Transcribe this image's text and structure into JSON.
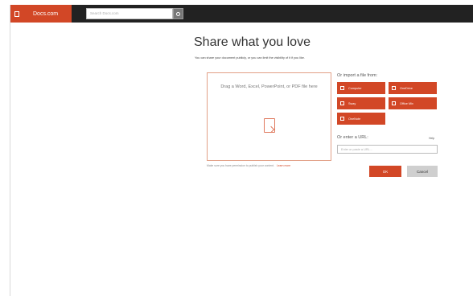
{
  "app": {
    "title": "Docs.com",
    "search_placeholder": "Search Docs.com",
    "brand_color": "#d24726"
  },
  "main": {
    "heading": "Share what you love",
    "subtext": "You can share your document publicly, or you can limit the visibility of it if you like.",
    "dropzone_text": "Drag a Word, Excel, PowerPoint, or PDF file here",
    "privacy_note": "Make sure you have permission to publish your content.",
    "privacy_link": "Learn more"
  },
  "import": {
    "label": "Or import a file from:",
    "sources": [
      {
        "label": "Computer",
        "icon": "computer-icon"
      },
      {
        "label": "OneDrive",
        "icon": "cloud-icon"
      },
      {
        "label": "Sway",
        "icon": "sway-icon"
      },
      {
        "label": "Office Mix",
        "icon": "office-mix-icon"
      },
      {
        "label": "OneNote",
        "icon": "onenote-icon"
      }
    ]
  },
  "url": {
    "label": "Or enter a URL:",
    "help": "Help",
    "placeholder": "Enter or paste a URL..."
  },
  "actions": {
    "ok": "OK",
    "cancel": "Cancel"
  }
}
